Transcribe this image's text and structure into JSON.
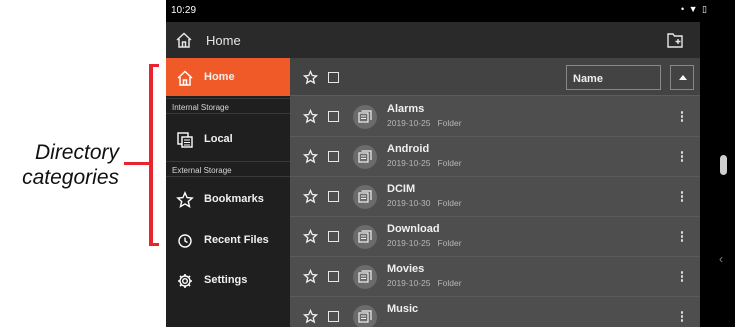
{
  "annotation": {
    "line1": "Directory",
    "line2": "categories",
    "color": "#e8252d"
  },
  "status": {
    "time": "10:29",
    "icons": "• ▼ ▯"
  },
  "appbar": {
    "title": "Home"
  },
  "sidebar": {
    "items": [
      {
        "label": "Home",
        "icon": "home-icon",
        "active": true
      },
      {
        "section": "Internal Storage"
      },
      {
        "label": "Local",
        "icon": "storage-icon"
      },
      {
        "section": "External Storage"
      },
      {
        "label": "Bookmarks",
        "icon": "star-icon"
      },
      {
        "label": "Recent Files",
        "icon": "clock-icon"
      },
      {
        "label": "Settings",
        "icon": "gear-icon"
      }
    ],
    "accent": "#f05a28"
  },
  "content": {
    "sort_label": "Name",
    "rows": [
      {
        "name": "Alarms",
        "date": "2019-10-25",
        "type": "Folder"
      },
      {
        "name": "Android",
        "date": "2019-10-25",
        "type": "Folder"
      },
      {
        "name": "DCIM",
        "date": "2019-10-30",
        "type": "Folder"
      },
      {
        "name": "Download",
        "date": "2019-10-25",
        "type": "Folder"
      },
      {
        "name": "Movies",
        "date": "2019-10-25",
        "type": "Folder"
      },
      {
        "name": "Music",
        "date": "",
        "type": ""
      }
    ]
  }
}
